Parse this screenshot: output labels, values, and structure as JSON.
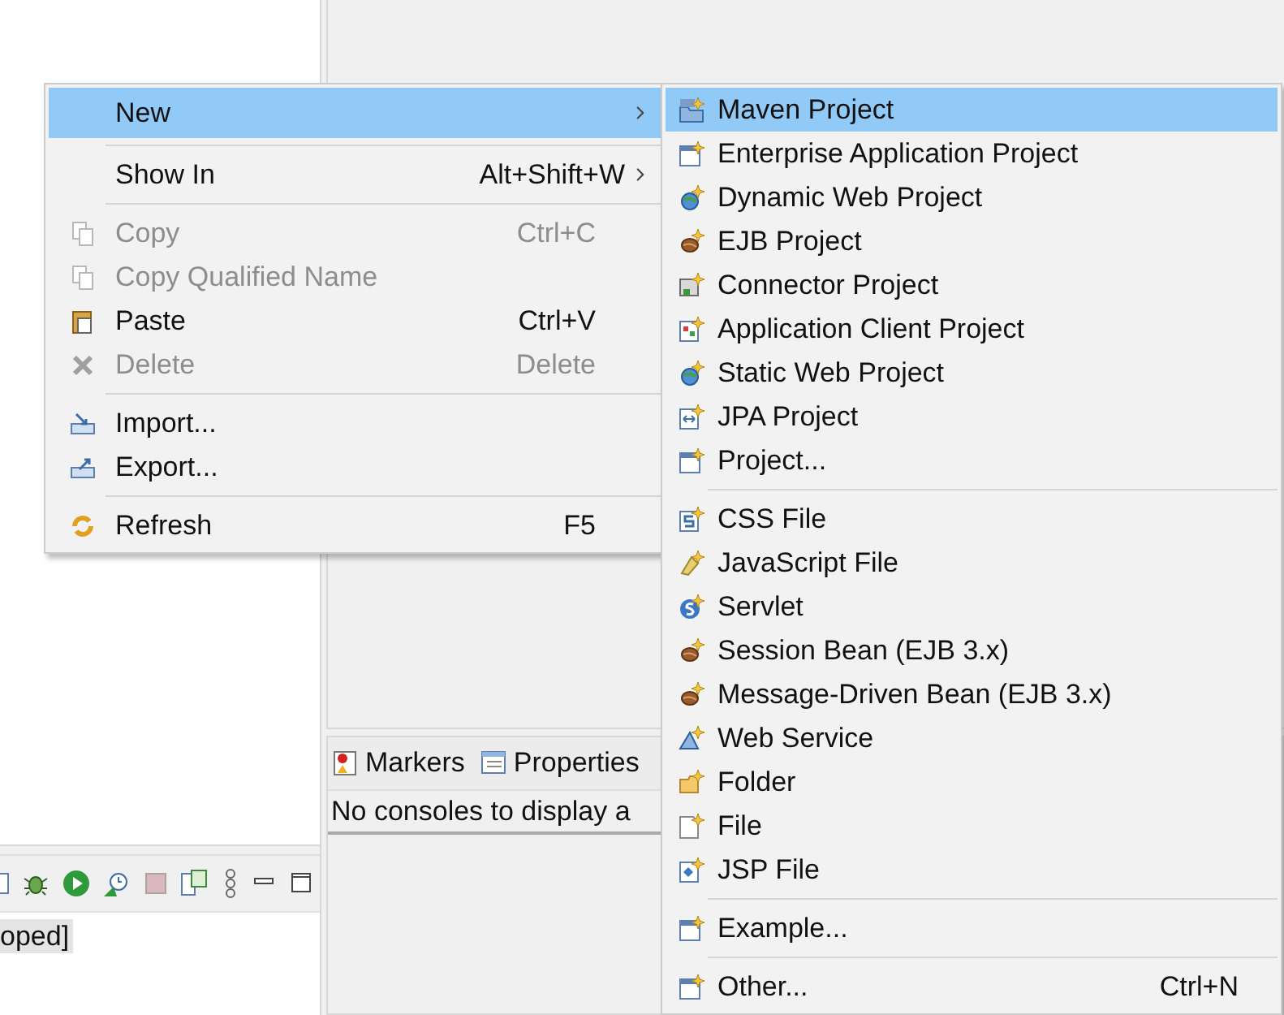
{
  "context_menu": {
    "items": [
      {
        "kind": "item",
        "label": "New",
        "has_submenu": true,
        "disabled": false,
        "selected": true
      },
      {
        "kind": "separator"
      },
      {
        "kind": "item",
        "label": "Show In",
        "shortcut": "Alt+Shift+W",
        "has_submenu": true,
        "disabled": false,
        "selected": false
      },
      {
        "kind": "separator"
      },
      {
        "kind": "item",
        "label": "Copy",
        "shortcut": "Ctrl+C",
        "has_submenu": false,
        "disabled": true,
        "selected": false
      },
      {
        "kind": "item",
        "label": "Copy Qualified Name",
        "has_submenu": false,
        "disabled": true,
        "selected": false
      },
      {
        "kind": "item",
        "label": "Paste",
        "shortcut": "Ctrl+V",
        "has_submenu": false,
        "disabled": false,
        "selected": false
      },
      {
        "kind": "item",
        "label": "Delete",
        "shortcut": "Delete",
        "has_submenu": false,
        "disabled": true,
        "selected": false
      },
      {
        "kind": "separator"
      },
      {
        "kind": "item",
        "label": "Import...",
        "has_submenu": false,
        "disabled": false,
        "selected": false
      },
      {
        "kind": "item",
        "label": "Export...",
        "has_submenu": false,
        "disabled": false,
        "selected": false
      },
      {
        "kind": "separator"
      },
      {
        "kind": "item",
        "label": "Refresh",
        "shortcut": "F5",
        "has_submenu": false,
        "disabled": false,
        "selected": false
      }
    ]
  },
  "new_submenu": {
    "items": [
      {
        "kind": "item",
        "label": "Maven Project",
        "selected": true
      },
      {
        "kind": "item",
        "label": "Enterprise Application Project",
        "selected": false
      },
      {
        "kind": "item",
        "label": "Dynamic Web Project",
        "selected": false
      },
      {
        "kind": "item",
        "label": "EJB Project",
        "selected": false
      },
      {
        "kind": "item",
        "label": "Connector Project",
        "selected": false
      },
      {
        "kind": "item",
        "label": "Application Client Project",
        "selected": false
      },
      {
        "kind": "item",
        "label": "Static Web Project",
        "selected": false
      },
      {
        "kind": "item",
        "label": "JPA Project",
        "selected": false
      },
      {
        "kind": "item",
        "label": "Project...",
        "selected": false
      },
      {
        "kind": "separator"
      },
      {
        "kind": "item",
        "label": "CSS File",
        "selected": false
      },
      {
        "kind": "item",
        "label": "JavaScript File",
        "selected": false
      },
      {
        "kind": "item",
        "label": "Servlet",
        "selected": false
      },
      {
        "kind": "item",
        "label": "Session Bean (EJB 3.x)",
        "selected": false
      },
      {
        "kind": "item",
        "label": "Message-Driven Bean (EJB 3.x)",
        "selected": false
      },
      {
        "kind": "item",
        "label": "Web Service",
        "selected": false
      },
      {
        "kind": "item",
        "label": "Folder",
        "selected": false
      },
      {
        "kind": "item",
        "label": "File",
        "selected": false
      },
      {
        "kind": "item",
        "label": "JSP File",
        "selected": false
      },
      {
        "kind": "separator"
      },
      {
        "kind": "item",
        "label": "Example...",
        "selected": false
      },
      {
        "kind": "separator"
      },
      {
        "kind": "item",
        "label": "Other...",
        "shortcut": "Ctrl+N",
        "selected": false
      }
    ]
  },
  "bottom_panel": {
    "tabs": [
      {
        "label": "Markers"
      },
      {
        "label": "Properties"
      }
    ],
    "message": "No consoles to display a"
  },
  "servers_panel": {
    "row_text": "oped]"
  }
}
